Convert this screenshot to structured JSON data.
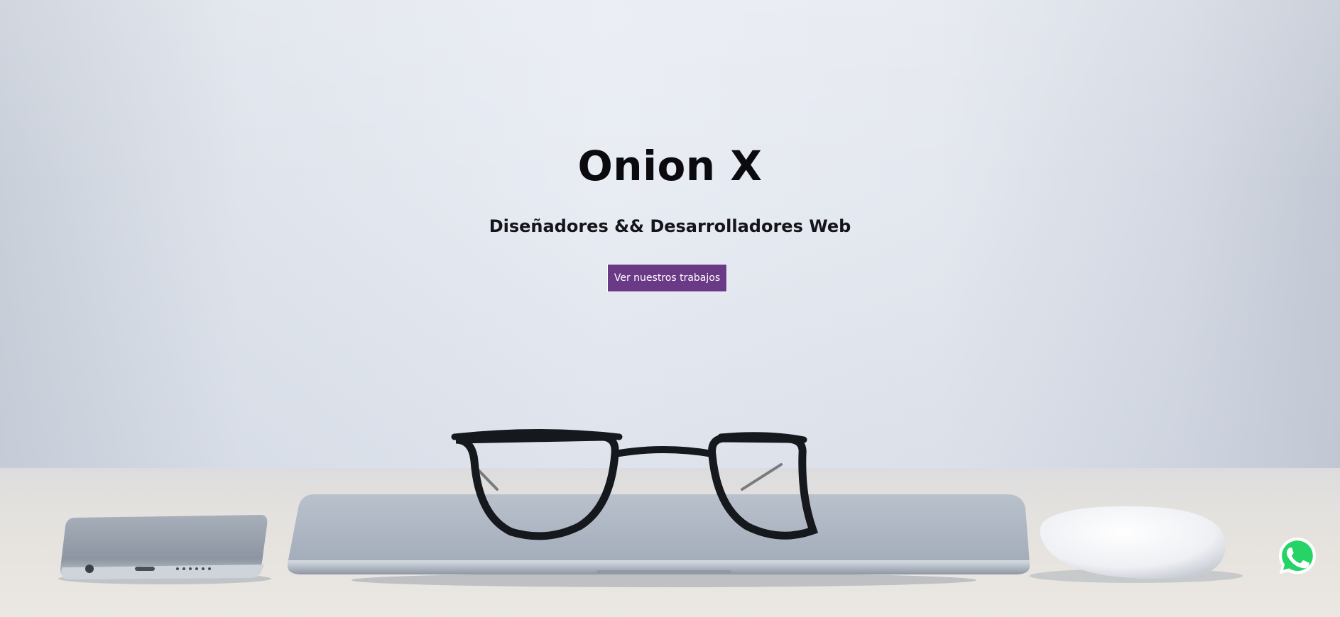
{
  "hero": {
    "title": "Onion X",
    "subtitle": "Diseñadores && Desarrolladores Web",
    "cta_label": "Ver nuestros trabajos"
  },
  "floating": {
    "whatsapp_icon": "whatsapp-icon"
  },
  "colors": {
    "accent": "#6a3a86",
    "whatsapp_green": "#25d366",
    "text": "#0b0b0f"
  }
}
